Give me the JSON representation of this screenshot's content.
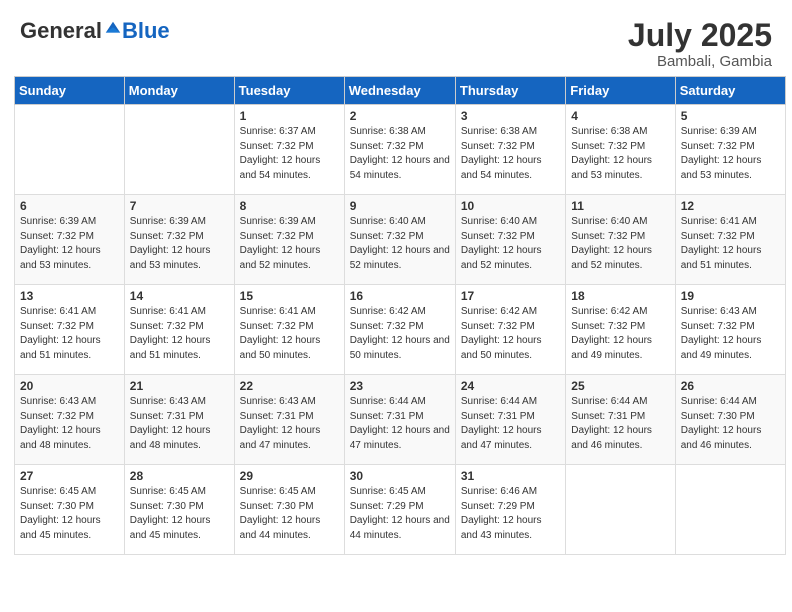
{
  "header": {
    "logo_general": "General",
    "logo_blue": "Blue",
    "month_year": "July 2025",
    "location": "Bambali, Gambia"
  },
  "days_of_week": [
    "Sunday",
    "Monday",
    "Tuesday",
    "Wednesday",
    "Thursday",
    "Friday",
    "Saturday"
  ],
  "weeks": [
    [
      {
        "day": "",
        "info": ""
      },
      {
        "day": "",
        "info": ""
      },
      {
        "day": "1",
        "info": "Sunrise: 6:37 AM\nSunset: 7:32 PM\nDaylight: 12 hours and 54 minutes."
      },
      {
        "day": "2",
        "info": "Sunrise: 6:38 AM\nSunset: 7:32 PM\nDaylight: 12 hours and 54 minutes."
      },
      {
        "day": "3",
        "info": "Sunrise: 6:38 AM\nSunset: 7:32 PM\nDaylight: 12 hours and 54 minutes."
      },
      {
        "day": "4",
        "info": "Sunrise: 6:38 AM\nSunset: 7:32 PM\nDaylight: 12 hours and 53 minutes."
      },
      {
        "day": "5",
        "info": "Sunrise: 6:39 AM\nSunset: 7:32 PM\nDaylight: 12 hours and 53 minutes."
      }
    ],
    [
      {
        "day": "6",
        "info": "Sunrise: 6:39 AM\nSunset: 7:32 PM\nDaylight: 12 hours and 53 minutes."
      },
      {
        "day": "7",
        "info": "Sunrise: 6:39 AM\nSunset: 7:32 PM\nDaylight: 12 hours and 53 minutes."
      },
      {
        "day": "8",
        "info": "Sunrise: 6:39 AM\nSunset: 7:32 PM\nDaylight: 12 hours and 52 minutes."
      },
      {
        "day": "9",
        "info": "Sunrise: 6:40 AM\nSunset: 7:32 PM\nDaylight: 12 hours and 52 minutes."
      },
      {
        "day": "10",
        "info": "Sunrise: 6:40 AM\nSunset: 7:32 PM\nDaylight: 12 hours and 52 minutes."
      },
      {
        "day": "11",
        "info": "Sunrise: 6:40 AM\nSunset: 7:32 PM\nDaylight: 12 hours and 52 minutes."
      },
      {
        "day": "12",
        "info": "Sunrise: 6:41 AM\nSunset: 7:32 PM\nDaylight: 12 hours and 51 minutes."
      }
    ],
    [
      {
        "day": "13",
        "info": "Sunrise: 6:41 AM\nSunset: 7:32 PM\nDaylight: 12 hours and 51 minutes."
      },
      {
        "day": "14",
        "info": "Sunrise: 6:41 AM\nSunset: 7:32 PM\nDaylight: 12 hours and 51 minutes."
      },
      {
        "day": "15",
        "info": "Sunrise: 6:41 AM\nSunset: 7:32 PM\nDaylight: 12 hours and 50 minutes."
      },
      {
        "day": "16",
        "info": "Sunrise: 6:42 AM\nSunset: 7:32 PM\nDaylight: 12 hours and 50 minutes."
      },
      {
        "day": "17",
        "info": "Sunrise: 6:42 AM\nSunset: 7:32 PM\nDaylight: 12 hours and 50 minutes."
      },
      {
        "day": "18",
        "info": "Sunrise: 6:42 AM\nSunset: 7:32 PM\nDaylight: 12 hours and 49 minutes."
      },
      {
        "day": "19",
        "info": "Sunrise: 6:43 AM\nSunset: 7:32 PM\nDaylight: 12 hours and 49 minutes."
      }
    ],
    [
      {
        "day": "20",
        "info": "Sunrise: 6:43 AM\nSunset: 7:32 PM\nDaylight: 12 hours and 48 minutes."
      },
      {
        "day": "21",
        "info": "Sunrise: 6:43 AM\nSunset: 7:31 PM\nDaylight: 12 hours and 48 minutes."
      },
      {
        "day": "22",
        "info": "Sunrise: 6:43 AM\nSunset: 7:31 PM\nDaylight: 12 hours and 47 minutes."
      },
      {
        "day": "23",
        "info": "Sunrise: 6:44 AM\nSunset: 7:31 PM\nDaylight: 12 hours and 47 minutes."
      },
      {
        "day": "24",
        "info": "Sunrise: 6:44 AM\nSunset: 7:31 PM\nDaylight: 12 hours and 47 minutes."
      },
      {
        "day": "25",
        "info": "Sunrise: 6:44 AM\nSunset: 7:31 PM\nDaylight: 12 hours and 46 minutes."
      },
      {
        "day": "26",
        "info": "Sunrise: 6:44 AM\nSunset: 7:30 PM\nDaylight: 12 hours and 46 minutes."
      }
    ],
    [
      {
        "day": "27",
        "info": "Sunrise: 6:45 AM\nSunset: 7:30 PM\nDaylight: 12 hours and 45 minutes."
      },
      {
        "day": "28",
        "info": "Sunrise: 6:45 AM\nSunset: 7:30 PM\nDaylight: 12 hours and 45 minutes."
      },
      {
        "day": "29",
        "info": "Sunrise: 6:45 AM\nSunset: 7:30 PM\nDaylight: 12 hours and 44 minutes."
      },
      {
        "day": "30",
        "info": "Sunrise: 6:45 AM\nSunset: 7:29 PM\nDaylight: 12 hours and 44 minutes."
      },
      {
        "day": "31",
        "info": "Sunrise: 6:46 AM\nSunset: 7:29 PM\nDaylight: 12 hours and 43 minutes."
      },
      {
        "day": "",
        "info": ""
      },
      {
        "day": "",
        "info": ""
      }
    ]
  ]
}
